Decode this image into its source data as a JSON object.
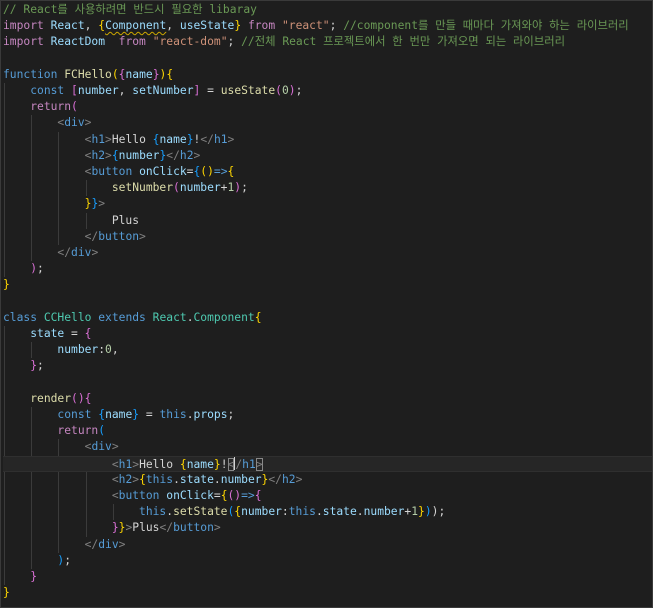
{
  "colors": {
    "background": "#1e1e1e",
    "comment": "#6a9955",
    "keyword": "#569cd6",
    "control": "#c586c0",
    "string": "#ce9178",
    "function": "#dcdcaa",
    "variable": "#9cdcfe",
    "type": "#4ec9b0",
    "number": "#b5cea8",
    "tag": "#569cd6",
    "bracket_gold": "#ffd700",
    "bracket_purple": "#da70d6",
    "bracket_blue": "#179fff",
    "text": "#d4d4d4",
    "tag_punct": "#808080"
  },
  "code_lines": [
    [
      {
        "t": "// React를 사용하려면 반드시 필요한 libaray",
        "c": "comment"
      }
    ],
    [
      {
        "t": "import",
        "c": "control"
      },
      {
        "t": " ",
        "c": "text"
      },
      {
        "t": "React",
        "c": "variable"
      },
      {
        "t": ", ",
        "c": "text"
      },
      {
        "t": "{",
        "c": "bracket_gold"
      },
      {
        "t": "Component",
        "c": "variable",
        "squiggle": true
      },
      {
        "t": ", ",
        "c": "text"
      },
      {
        "t": "useState",
        "c": "variable"
      },
      {
        "t": "}",
        "c": "bracket_gold"
      },
      {
        "t": " ",
        "c": "text"
      },
      {
        "t": "from",
        "c": "control"
      },
      {
        "t": " ",
        "c": "text"
      },
      {
        "t": "\"react\"",
        "c": "string"
      },
      {
        "t": "; ",
        "c": "text"
      },
      {
        "t": "//component를 만들 때마다 가져와야 하는 라이브러리",
        "c": "comment"
      }
    ],
    [
      {
        "t": "import",
        "c": "control"
      },
      {
        "t": " ",
        "c": "text"
      },
      {
        "t": "ReactDom",
        "c": "variable"
      },
      {
        "t": "  ",
        "c": "text"
      },
      {
        "t": "from",
        "c": "control"
      },
      {
        "t": " ",
        "c": "text"
      },
      {
        "t": "\"react-dom\"",
        "c": "string"
      },
      {
        "t": "; ",
        "c": "text"
      },
      {
        "t": "//전체 React 프로젝트에서 한 번만 가져오면 되는 라이브러리",
        "c": "comment"
      }
    ],
    [],
    [
      {
        "t": "function",
        "c": "keyword"
      },
      {
        "t": " ",
        "c": "text"
      },
      {
        "t": "FCHello",
        "c": "function"
      },
      {
        "t": "(",
        "c": "bracket_gold"
      },
      {
        "t": "{",
        "c": "bracket_purple"
      },
      {
        "t": "name",
        "c": "variable"
      },
      {
        "t": "}",
        "c": "bracket_purple"
      },
      {
        "t": ")",
        "c": "bracket_gold"
      },
      {
        "t": "{",
        "c": "bracket_gold"
      }
    ],
    [
      {
        "t": "    ",
        "c": "text"
      },
      {
        "t": "const",
        "c": "keyword"
      },
      {
        "t": " ",
        "c": "text"
      },
      {
        "t": "[",
        "c": "bracket_purple"
      },
      {
        "t": "number",
        "c": "variable"
      },
      {
        "t": ", ",
        "c": "text"
      },
      {
        "t": "setNumber",
        "c": "variable"
      },
      {
        "t": "]",
        "c": "bracket_purple"
      },
      {
        "t": " = ",
        "c": "text"
      },
      {
        "t": "useState",
        "c": "function"
      },
      {
        "t": "(",
        "c": "bracket_purple"
      },
      {
        "t": "0",
        "c": "number"
      },
      {
        "t": ")",
        "c": "bracket_purple"
      },
      {
        "t": ";",
        "c": "text"
      }
    ],
    [
      {
        "t": "    ",
        "c": "text"
      },
      {
        "t": "return",
        "c": "control"
      },
      {
        "t": "(",
        "c": "bracket_purple"
      }
    ],
    [
      {
        "t": "        ",
        "c": "text"
      },
      {
        "t": "<",
        "c": "tag_punct"
      },
      {
        "t": "div",
        "c": "tag"
      },
      {
        "t": ">",
        "c": "tag_punct"
      }
    ],
    [
      {
        "t": "            ",
        "c": "text"
      },
      {
        "t": "<",
        "c": "tag_punct"
      },
      {
        "t": "h1",
        "c": "tag"
      },
      {
        "t": ">",
        "c": "tag_punct"
      },
      {
        "t": "Hello ",
        "c": "text"
      },
      {
        "t": "{",
        "c": "bracket_blue"
      },
      {
        "t": "name",
        "c": "variable"
      },
      {
        "t": "}",
        "c": "bracket_blue"
      },
      {
        "t": "!",
        "c": "text"
      },
      {
        "t": "</",
        "c": "tag_punct"
      },
      {
        "t": "h1",
        "c": "tag"
      },
      {
        "t": ">",
        "c": "tag_punct"
      }
    ],
    [
      {
        "t": "            ",
        "c": "text"
      },
      {
        "t": "<",
        "c": "tag_punct"
      },
      {
        "t": "h2",
        "c": "tag"
      },
      {
        "t": ">",
        "c": "tag_punct"
      },
      {
        "t": "{",
        "c": "bracket_blue"
      },
      {
        "t": "number",
        "c": "variable"
      },
      {
        "t": "}",
        "c": "bracket_blue"
      },
      {
        "t": "</",
        "c": "tag_punct"
      },
      {
        "t": "h2",
        "c": "tag"
      },
      {
        "t": ">",
        "c": "tag_punct"
      }
    ],
    [
      {
        "t": "            ",
        "c": "text"
      },
      {
        "t": "<",
        "c": "tag_punct"
      },
      {
        "t": "button",
        "c": "tag"
      },
      {
        "t": " ",
        "c": "text"
      },
      {
        "t": "onClick",
        "c": "variable"
      },
      {
        "t": "=",
        "c": "text"
      },
      {
        "t": "{",
        "c": "bracket_blue"
      },
      {
        "t": "()",
        "c": "bracket_gold"
      },
      {
        "t": "=>",
        "c": "keyword"
      },
      {
        "t": "{",
        "c": "bracket_gold"
      }
    ],
    [
      {
        "t": "                ",
        "c": "text"
      },
      {
        "t": "setNumber",
        "c": "function"
      },
      {
        "t": "(",
        "c": "bracket_purple"
      },
      {
        "t": "number",
        "c": "variable"
      },
      {
        "t": "+",
        "c": "text"
      },
      {
        "t": "1",
        "c": "number"
      },
      {
        "t": ")",
        "c": "bracket_purple"
      },
      {
        "t": ";",
        "c": "text"
      }
    ],
    [
      {
        "t": "            ",
        "c": "text"
      },
      {
        "t": "}",
        "c": "bracket_gold"
      },
      {
        "t": "}",
        "c": "bracket_blue"
      },
      {
        "t": ">",
        "c": "tag_punct"
      }
    ],
    [
      {
        "t": "                ",
        "c": "text"
      },
      {
        "t": "Plus",
        "c": "text"
      }
    ],
    [
      {
        "t": "            ",
        "c": "text"
      },
      {
        "t": "</",
        "c": "tag_punct"
      },
      {
        "t": "button",
        "c": "tag"
      },
      {
        "t": ">",
        "c": "tag_punct"
      }
    ],
    [
      {
        "t": "        ",
        "c": "text"
      },
      {
        "t": "</",
        "c": "tag_punct"
      },
      {
        "t": "div",
        "c": "tag"
      },
      {
        "t": ">",
        "c": "tag_punct"
      }
    ],
    [
      {
        "t": "    ",
        "c": "text"
      },
      {
        "t": ")",
        "c": "bracket_purple"
      },
      {
        "t": ";",
        "c": "text"
      }
    ],
    [
      {
        "t": "}",
        "c": "bracket_gold"
      }
    ],
    [],
    [
      {
        "t": "class",
        "c": "keyword"
      },
      {
        "t": " ",
        "c": "text"
      },
      {
        "t": "CCHello",
        "c": "type"
      },
      {
        "t": " ",
        "c": "text"
      },
      {
        "t": "extends",
        "c": "keyword"
      },
      {
        "t": " ",
        "c": "text"
      },
      {
        "t": "React",
        "c": "type"
      },
      {
        "t": ".",
        "c": "text"
      },
      {
        "t": "Component",
        "c": "type"
      },
      {
        "t": "{",
        "c": "bracket_gold"
      }
    ],
    [
      {
        "t": "    ",
        "c": "text"
      },
      {
        "t": "state",
        "c": "variable"
      },
      {
        "t": " = ",
        "c": "text"
      },
      {
        "t": "{",
        "c": "bracket_purple"
      }
    ],
    [
      {
        "t": "        ",
        "c": "text"
      },
      {
        "t": "number",
        "c": "variable"
      },
      {
        "t": ":",
        "c": "text"
      },
      {
        "t": "0",
        "c": "number"
      },
      {
        "t": ",",
        "c": "text"
      }
    ],
    [
      {
        "t": "    ",
        "c": "text"
      },
      {
        "t": "}",
        "c": "bracket_purple"
      },
      {
        "t": ";",
        "c": "text"
      }
    ],
    [],
    [
      {
        "t": "    ",
        "c": "text"
      },
      {
        "t": "render",
        "c": "function"
      },
      {
        "t": "()",
        "c": "bracket_purple"
      },
      {
        "t": "{",
        "c": "bracket_purple"
      }
    ],
    [
      {
        "t": "        ",
        "c": "text"
      },
      {
        "t": "const",
        "c": "keyword"
      },
      {
        "t": " ",
        "c": "text"
      },
      {
        "t": "{",
        "c": "bracket_blue"
      },
      {
        "t": "name",
        "c": "variable"
      },
      {
        "t": "}",
        "c": "bracket_blue"
      },
      {
        "t": " = ",
        "c": "text"
      },
      {
        "t": "this",
        "c": "keyword"
      },
      {
        "t": ".",
        "c": "text"
      },
      {
        "t": "props",
        "c": "variable"
      },
      {
        "t": ";",
        "c": "text"
      }
    ],
    [
      {
        "t": "        ",
        "c": "text"
      },
      {
        "t": "return",
        "c": "control"
      },
      {
        "t": "(",
        "c": "bracket_blue"
      }
    ],
    [
      {
        "t": "            ",
        "c": "text"
      },
      {
        "t": "<",
        "c": "tag_punct"
      },
      {
        "t": "div",
        "c": "tag"
      },
      {
        "t": ">",
        "c": "tag_punct"
      }
    ],
    [
      {
        "t": "                ",
        "c": "text"
      },
      {
        "t": "<",
        "c": "tag_punct"
      },
      {
        "t": "h1",
        "c": "tag"
      },
      {
        "t": ">",
        "c": "tag_punct"
      },
      {
        "t": "Hello ",
        "c": "text"
      },
      {
        "t": "{",
        "c": "bracket_gold"
      },
      {
        "t": "name",
        "c": "variable"
      },
      {
        "t": "}",
        "c": "bracket_gold"
      },
      {
        "t": "!",
        "c": "text"
      },
      {
        "t": "<",
        "c": "tag_punct",
        "match": true
      },
      {
        "t": "CURSOR",
        "c": "cursor"
      },
      {
        "t": "/",
        "c": "tag_punct"
      },
      {
        "t": "h1",
        "c": "tag"
      },
      {
        "t": ">",
        "c": "tag_punct",
        "match": true
      }
    ],
    [
      {
        "t": "                ",
        "c": "text"
      },
      {
        "t": "<",
        "c": "tag_punct"
      },
      {
        "t": "h2",
        "c": "tag"
      },
      {
        "t": ">",
        "c": "tag_punct"
      },
      {
        "t": "{",
        "c": "bracket_gold"
      },
      {
        "t": "this",
        "c": "keyword"
      },
      {
        "t": ".",
        "c": "text"
      },
      {
        "t": "state",
        "c": "variable"
      },
      {
        "t": ".",
        "c": "text"
      },
      {
        "t": "number",
        "c": "variable"
      },
      {
        "t": "}",
        "c": "bracket_gold"
      },
      {
        "t": "</",
        "c": "tag_punct"
      },
      {
        "t": "h2",
        "c": "tag"
      },
      {
        "t": ">",
        "c": "tag_punct"
      }
    ],
    [
      {
        "t": "                ",
        "c": "text"
      },
      {
        "t": "<",
        "c": "tag_punct"
      },
      {
        "t": "button",
        "c": "tag"
      },
      {
        "t": " ",
        "c": "text"
      },
      {
        "t": "onClick",
        "c": "variable"
      },
      {
        "t": "=",
        "c": "text"
      },
      {
        "t": "{",
        "c": "bracket_gold"
      },
      {
        "t": "()",
        "c": "bracket_purple"
      },
      {
        "t": "=>",
        "c": "keyword"
      },
      {
        "t": "{",
        "c": "bracket_purple"
      }
    ],
    [
      {
        "t": "                    ",
        "c": "text"
      },
      {
        "t": "this",
        "c": "keyword"
      },
      {
        "t": ".",
        "c": "text"
      },
      {
        "t": "setState",
        "c": "function"
      },
      {
        "t": "(",
        "c": "bracket_blue"
      },
      {
        "t": "{",
        "c": "bracket_gold"
      },
      {
        "t": "number",
        "c": "variable"
      },
      {
        "t": ":",
        "c": "text"
      },
      {
        "t": "this",
        "c": "keyword"
      },
      {
        "t": ".",
        "c": "text"
      },
      {
        "t": "state",
        "c": "variable"
      },
      {
        "t": ".",
        "c": "text"
      },
      {
        "t": "number",
        "c": "variable"
      },
      {
        "t": "+",
        "c": "text"
      },
      {
        "t": "1",
        "c": "number"
      },
      {
        "t": "}",
        "c": "bracket_gold"
      },
      {
        "t": ")",
        "c": "bracket_blue"
      },
      {
        "t": ");",
        "c": "text"
      }
    ],
    [
      {
        "t": "                ",
        "c": "text"
      },
      {
        "t": "}",
        "c": "bracket_purple"
      },
      {
        "t": "}",
        "c": "bracket_gold"
      },
      {
        "t": ">",
        "c": "tag_punct"
      },
      {
        "t": "Plus",
        "c": "text"
      },
      {
        "t": "</",
        "c": "tag_punct"
      },
      {
        "t": "button",
        "c": "tag"
      },
      {
        "t": ">",
        "c": "tag_punct"
      }
    ],
    [
      {
        "t": "            ",
        "c": "text"
      },
      {
        "t": "</",
        "c": "tag_punct"
      },
      {
        "t": "div",
        "c": "tag"
      },
      {
        "t": ">",
        "c": "tag_punct"
      }
    ],
    [
      {
        "t": "        ",
        "c": "text"
      },
      {
        "t": ")",
        "c": "bracket_blue"
      },
      {
        "t": ";",
        "c": "text"
      }
    ],
    [
      {
        "t": "    ",
        "c": "text"
      },
      {
        "t": "}",
        "c": "bracket_purple"
      }
    ],
    [
      {
        "t": "}",
        "c": "bracket_gold"
      }
    ]
  ],
  "current_line_index": 28
}
